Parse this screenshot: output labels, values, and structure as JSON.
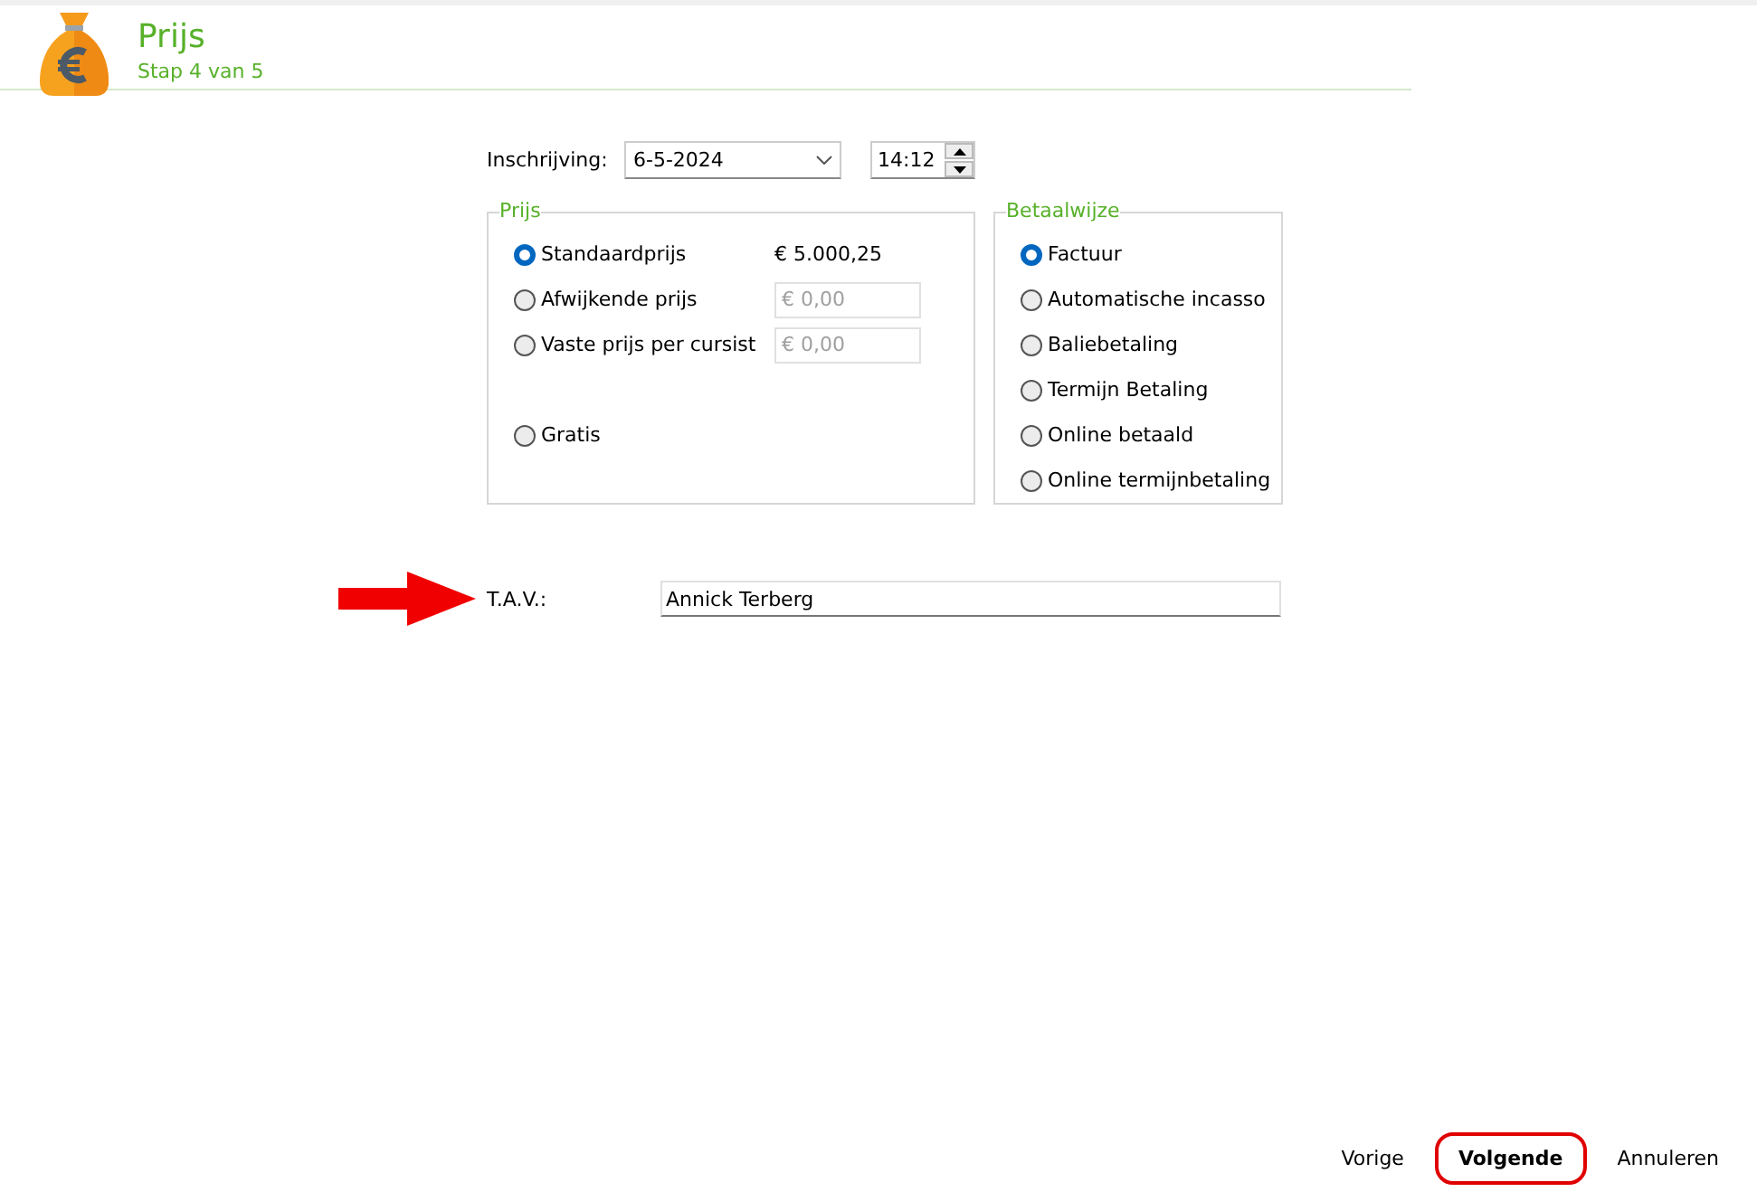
{
  "header": {
    "title": "Prijs",
    "subtitle": "Stap 4 van 5"
  },
  "registration": {
    "label": "Inschrijving:",
    "date": "6-5-2024",
    "time": "14:12"
  },
  "price_group": {
    "title": "Prijs",
    "options": [
      {
        "label": "Standaardprijs",
        "selected": true,
        "kind": "amount",
        "amount": "€ 5.000,25"
      },
      {
        "label": "Afwijkende prijs",
        "selected": false,
        "kind": "amount_field",
        "amount": "€ 0,00",
        "disabled": true
      },
      {
        "label": "Vaste prijs per cursist",
        "selected": false,
        "kind": "amount_field",
        "amount": "€ 0,00",
        "disabled": true
      },
      {
        "label": "Gratis",
        "selected": false,
        "kind": "plain"
      }
    ]
  },
  "payment_group": {
    "title": "Betaalwijze",
    "options": [
      {
        "label": "Factuur",
        "selected": true
      },
      {
        "label": "Automatische incasso",
        "selected": false
      },
      {
        "label": "Baliebetaling",
        "selected": false
      },
      {
        "label": "Termijn Betaling",
        "selected": false
      },
      {
        "label": "Online betaald",
        "selected": false
      },
      {
        "label": "Online termijnbetaling",
        "selected": false
      }
    ]
  },
  "attention": {
    "label": "T.A.V.:",
    "value": "Annick Terberg"
  },
  "buttons": [
    {
      "label": "Vorige",
      "default": false,
      "highlighted": false
    },
    {
      "label": "Volgende",
      "default": true,
      "highlighted": true
    },
    {
      "label": "Annuleren",
      "default": false,
      "highlighted": false
    }
  ]
}
